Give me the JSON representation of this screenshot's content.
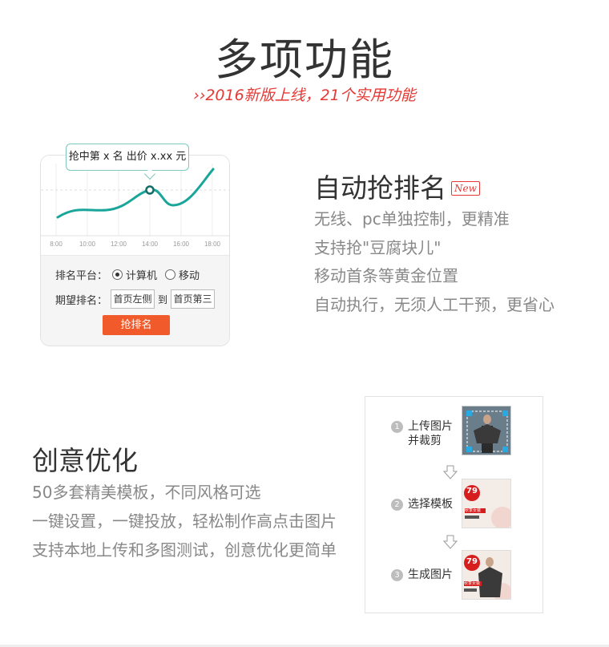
{
  "header": {
    "title": "多项功能",
    "subtitle": "››2016新版上线，21个实用功能"
  },
  "feature1": {
    "tooltip": "抢中第 x 名 出价 x.xx 元",
    "chart_x_labels": [
      "8:00",
      "10:00",
      "12:00",
      "14:00",
      "16:00",
      "18:00"
    ],
    "platform_label": "排名平台：",
    "option_computer": "计算机",
    "option_mobile": "移动",
    "rank_label": "期望排名：",
    "rank_from": "首页左侧",
    "rank_to_word": "到",
    "rank_to": "首页第三",
    "grab_button": "抢排名",
    "title": "自动抢排名",
    "new_badge": "New",
    "lines": [
      "无线、pc单独控制，更精准",
      "支持抢\"豆腐块儿\"",
      "移动首条等黄金位置",
      "自动执行，无须人工干预，更省心"
    ]
  },
  "feature2": {
    "title": "创意优化",
    "lines": [
      "50多套精美模板，不同风格可选",
      "一键设置，一键投放，轻松制作高点击图片",
      "支持本地上传和多图测试，创意优化更简单"
    ],
    "steps": [
      {
        "num": "1",
        "label_line1": "上传图片",
        "label_line2": "并裁剪"
      },
      {
        "num": "2",
        "label_line1": "选择模板",
        "label_line2": ""
      },
      {
        "num": "3",
        "label_line1": "生成图片",
        "label_line2": ""
      }
    ],
    "template_price": "79",
    "template_text": "秋季女装"
  },
  "colors": {
    "accent_red": "#e53935",
    "button_orange": "#f15a2a",
    "chart_teal": "#1aa59b"
  }
}
